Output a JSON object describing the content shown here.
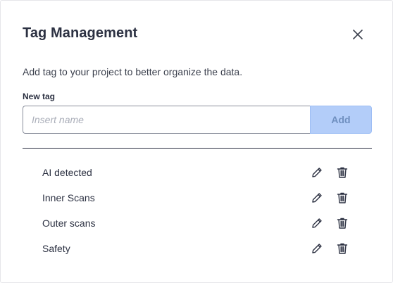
{
  "dialog": {
    "title": "Tag Management",
    "description": "Add tag to your project to better organize the data.",
    "new_tag_label": "New tag",
    "input": {
      "value": "",
      "placeholder": "Insert name"
    },
    "add_label": "Add",
    "tags": [
      {
        "name": "AI detected"
      },
      {
        "name": "Inner Scans"
      },
      {
        "name": "Outer scans"
      },
      {
        "name": "Safety"
      }
    ],
    "icons": {
      "close": "close-icon",
      "edit": "pencil-icon",
      "delete": "trash-icon"
    },
    "colors": {
      "add_button_bg": "#b3cdf9",
      "text": "#2c3142"
    }
  }
}
